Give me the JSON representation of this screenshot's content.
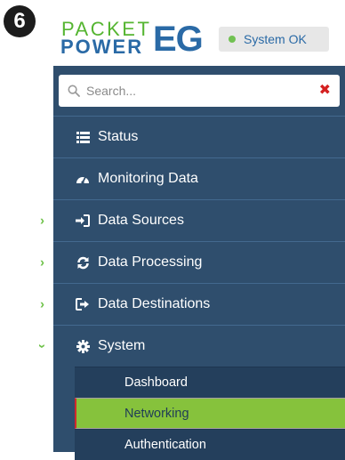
{
  "step_number": "6",
  "logo": {
    "line1": "PACKET",
    "line2": "POWER",
    "brand": "EG"
  },
  "status": {
    "text": "System OK",
    "dot_color": "#71c152"
  },
  "search": {
    "placeholder": "Search...",
    "clear_icon": "close-icon"
  },
  "menu": [
    {
      "label": "Status",
      "icon": "list-icon",
      "has_chevron": false
    },
    {
      "label": "Monitoring Data",
      "icon": "dashboard-gauge-icon",
      "has_chevron": false
    },
    {
      "label": "Data Sources",
      "icon": "sign-in-icon",
      "has_chevron": true
    },
    {
      "label": "Data Processing",
      "icon": "refresh-icon",
      "has_chevron": true
    },
    {
      "label": "Data Destinations",
      "icon": "sign-out-icon",
      "has_chevron": true
    },
    {
      "label": "System",
      "icon": "gear-icon",
      "has_chevron": true,
      "expanded": true
    }
  ],
  "submenu": [
    {
      "label": "Dashboard",
      "active": false
    },
    {
      "label": "Networking",
      "active": true
    },
    {
      "label": "Authentication",
      "active": false
    }
  ],
  "colors": {
    "sidebar_bg": "#2f4e6d",
    "submenu_bg": "#243f5c",
    "active_bg": "#86c23c",
    "chevron": "#6fc24a",
    "brand_blue": "#2a6aa6",
    "brand_green": "#55b531"
  }
}
